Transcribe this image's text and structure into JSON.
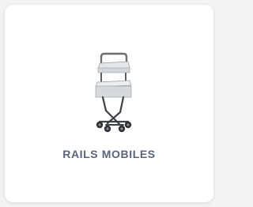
{
  "card": {
    "title": "RAILS MOBILES",
    "image_icon": "mobile-cart-with-two-trays",
    "title_color": "#5a6478"
  }
}
